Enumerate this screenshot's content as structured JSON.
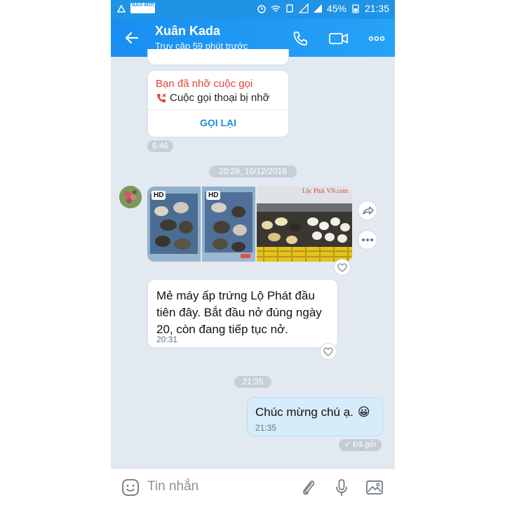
{
  "status_bar": {
    "left_badge": "BÁO MỚI",
    "battery_percent": "45%",
    "time": "21:35"
  },
  "header": {
    "contact_name": "Xuân Kada",
    "last_seen": "Truy cập 59 phút trước",
    "icons": [
      "back-arrow-icon",
      "phone-icon",
      "video-call-icon",
      "more-icon"
    ]
  },
  "missed_call": {
    "title": "Bạn đã nhỡ cuộc gọi",
    "subtitle": "Cuộc gọi thoại bị nhỡ",
    "action": "GỌI LẠI",
    "time": "6:46"
  },
  "date_divider": "20:28, 10/12/2018",
  "photos": {
    "badges": [
      "HD",
      "HD"
    ],
    "watermark": "Lộc Phát VN.com"
  },
  "incoming_message": {
    "text": "Mẻ máy ấp trứng Lộ Phát đầu tiên đây. Bắt đầu nở đúng ngày 20, còn đang tiếp tục nở.",
    "time": "20:31"
  },
  "time_divider": "21:35",
  "outgoing_message": {
    "text": "Chúc mừng chú ạ.",
    "emoji": "😀",
    "time": "21:35",
    "status": "Đã gửi"
  },
  "composer": {
    "placeholder": "Tin nhắn"
  },
  "colors": {
    "header_blue": "#1b8ef2",
    "missed_red": "#e0443b",
    "link_blue": "#1a8de0",
    "chat_bg": "#e3e9f1",
    "my_bubble": "#d6ecfb"
  }
}
